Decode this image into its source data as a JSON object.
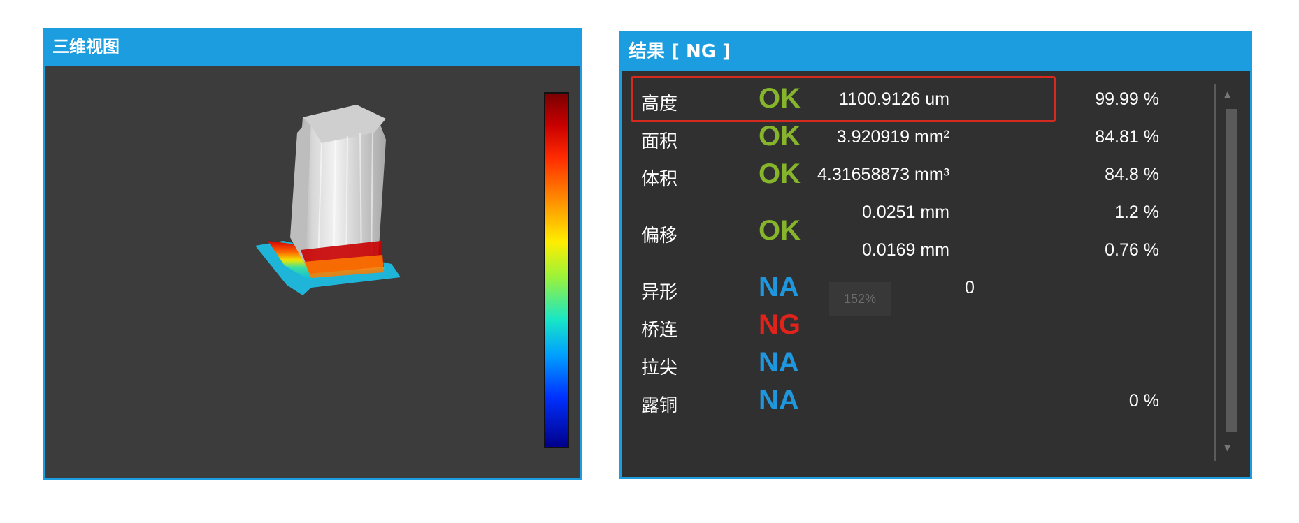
{
  "view3d": {
    "title": "三维视图"
  },
  "result": {
    "title": "结果 [ NG ]",
    "rows": [
      {
        "label": "高度",
        "status": "OK",
        "value": "1100.9126 um",
        "pct": "99.99 %"
      },
      {
        "label": "面积",
        "status": "OK",
        "value": "3.920919 mm²",
        "pct": "84.81 %"
      },
      {
        "label": "体积",
        "status": "OK",
        "value": "4.31658873 mm³",
        "pct": "84.8 %"
      },
      {
        "label": "偏移",
        "status": "OK",
        "values": [
          "0.0251 mm",
          "0.0169 mm"
        ],
        "pcts": [
          "1.2 %",
          "0.76 %"
        ]
      },
      {
        "label": "异形",
        "status": "NA",
        "value": "0",
        "pct": ""
      },
      {
        "label": "桥连",
        "status": "NG",
        "value": "",
        "pct": ""
      },
      {
        "label": "拉尖",
        "status": "NA",
        "value": "",
        "pct": ""
      },
      {
        "label": "露铜",
        "status": "NA",
        "value": "",
        "pct": "0 %"
      }
    ],
    "zoom_tip": "152%"
  },
  "colors": {
    "accent": "#1b9de0",
    "ok": "#86b52b",
    "na": "#1f97df",
    "ng": "#e0231b",
    "highlight": "#d42a20"
  }
}
